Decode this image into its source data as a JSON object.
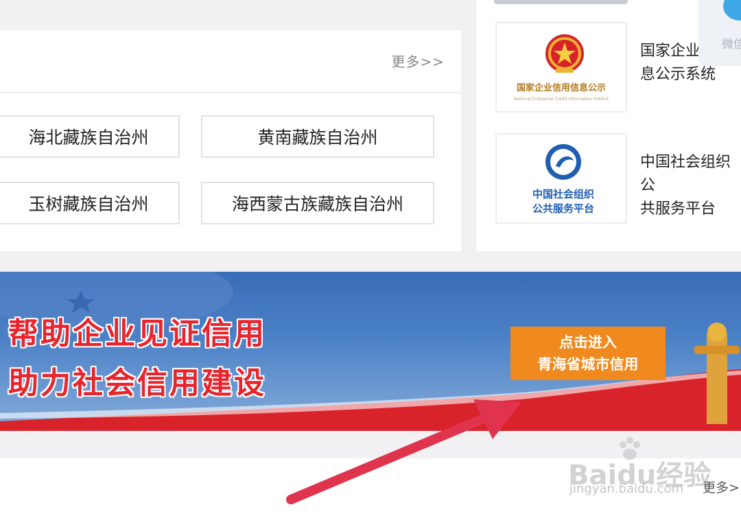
{
  "regions": {
    "more_label": "更多>>",
    "items": [
      "海北藏族自治州",
      "黄南藏族自治州",
      "玉树藏族自治州",
      "海西蒙古族藏族自治州"
    ]
  },
  "systems": [
    {
      "logo_text_cn": "国家企业信用信息公示",
      "logo_text_en": "National Enterprise Credit Information Publicit",
      "label": "国家企业\n息公示系统"
    },
    {
      "logo_text_cn_line1": "中国社会组织",
      "logo_text_cn_line2": "公共服务平台",
      "label": "中国社会组织公\n共服务平台"
    }
  ],
  "wechat": {
    "label": "微信"
  },
  "banner": {
    "slogan_line1": "帮助企业见证信用",
    "slogan_line2": "助力社会信用建设",
    "button_line1": "点击进入",
    "button_line2": "青海省城市信用"
  },
  "footer": {
    "more_label": "更多>"
  },
  "watermark": {
    "brand": "Baidu经验",
    "url": "jingyan.baidu.com"
  },
  "colors": {
    "accent_orange": "#f08a1e",
    "slogan_red": "#e8242c",
    "arrow_red": "#e0344e"
  }
}
